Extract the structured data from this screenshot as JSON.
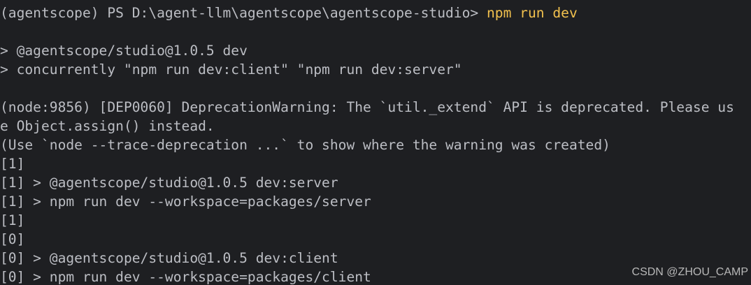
{
  "terminal": {
    "colors": {
      "background": "#1e1f22",
      "text": "#bcbec4",
      "command": "#f2c14e"
    },
    "prompt": {
      "path": "(agentscope) PS D:\\agent-llm\\agentscope\\agentscope-studio> ",
      "command": "npm run dev"
    },
    "lines": [
      "> @agentscope/studio@1.0.5 dev",
      "> concurrently \"npm run dev:client\" \"npm run dev:server\"",
      "",
      "(node:9856) [DEP0060] DeprecationWarning: The `util._extend` API is deprecated. Please us",
      "e Object.assign() instead.",
      "(Use `node --trace-deprecation ...` to show where the warning was created)",
      "[1]",
      "[1] > @agentscope/studio@1.0.5 dev:server",
      "[1] > npm run dev --workspace=packages/server",
      "[1]",
      "[0]",
      "[0] > @agentscope/studio@1.0.5 dev:client",
      "[0] > npm run dev --workspace=packages/client"
    ]
  },
  "watermark": "CSDN @ZHOU_CAMP"
}
